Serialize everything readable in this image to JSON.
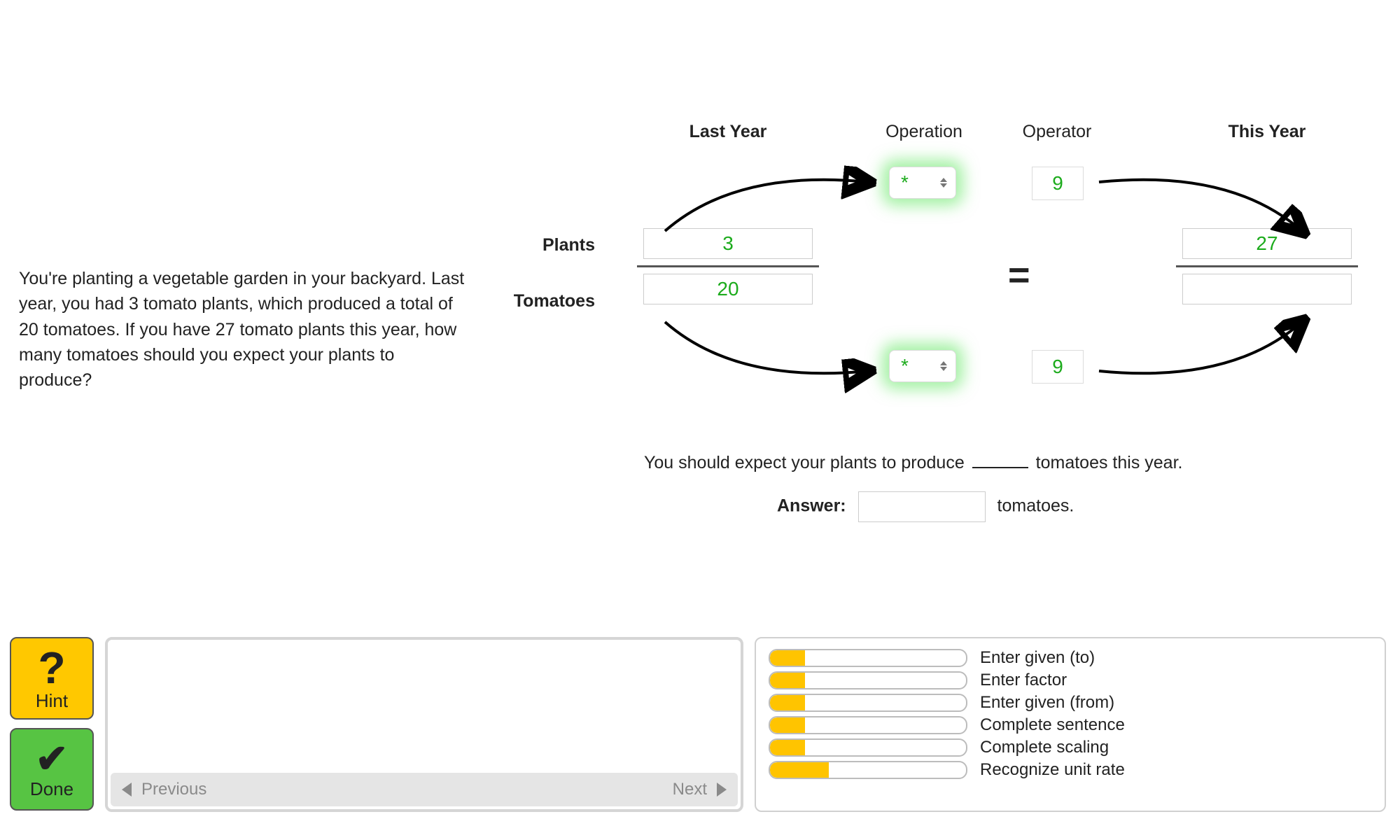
{
  "problem_text": "You're planting a vegetable garden in your backyard. Last year, you had 3 tomato plants, which produced a total of 20 tomatoes. If you have 27 tomato plants this year, how many tomatoes should you expect your plants to produce?",
  "headers": {
    "last_year": "Last Year",
    "operation": "Operation",
    "operator": "Operator",
    "this_year": "This Year"
  },
  "row_labels": {
    "plants": "Plants",
    "tomatoes": "Tomatoes"
  },
  "values": {
    "last_year_plants": "3",
    "last_year_tomatoes": "20",
    "this_year_plants": "27",
    "this_year_tomatoes": "",
    "operation_top": "*",
    "operation_bottom": "*",
    "factor_top": "9",
    "factor_bottom": "9"
  },
  "equals": "=",
  "sentence": {
    "pre": "You should expect your plants to produce",
    "post": "tomatoes this year."
  },
  "answer": {
    "label": "Answer:",
    "value": "",
    "unit": "tomatoes."
  },
  "buttons": {
    "hint_glyph": "?",
    "hint_label": "Hint",
    "done_glyph": "✔",
    "done_label": "Done",
    "previous": "Previous",
    "next": "Next"
  },
  "skills": [
    {
      "label": "Enter given (to)",
      "pct": 18
    },
    {
      "label": "Enter factor",
      "pct": 18
    },
    {
      "label": "Enter given (from)",
      "pct": 18
    },
    {
      "label": "Complete sentence",
      "pct": 18
    },
    {
      "label": "Complete scaling",
      "pct": 18
    },
    {
      "label": "Recognize unit rate",
      "pct": 30
    }
  ]
}
